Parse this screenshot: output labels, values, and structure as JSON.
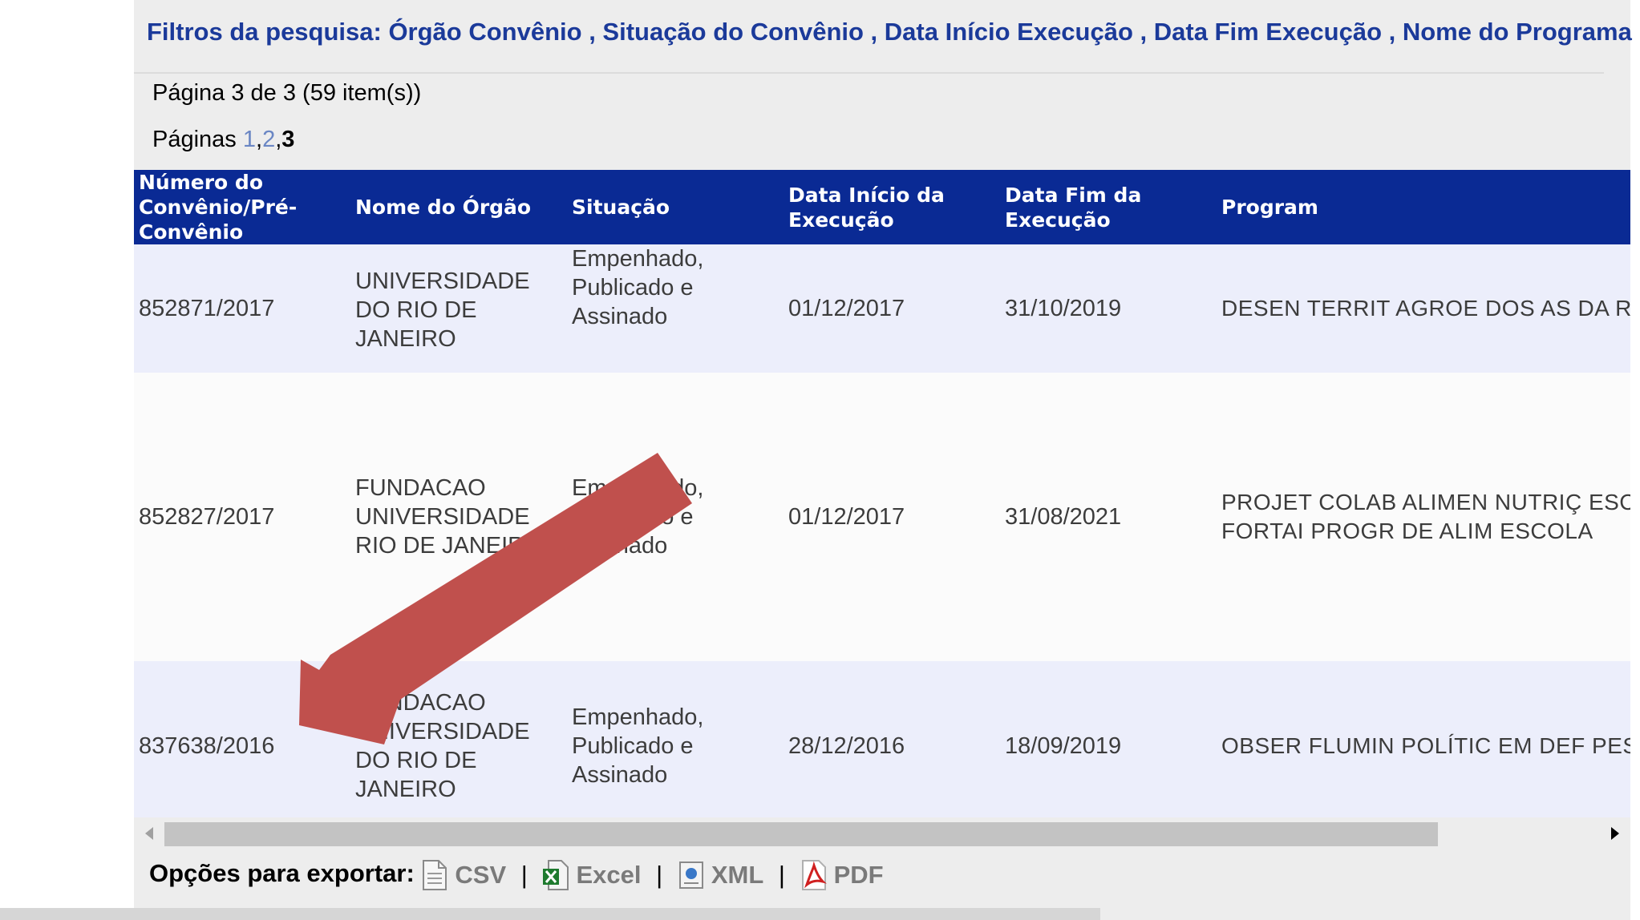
{
  "filters_text": "Filtros da pesquisa: Órgão Convênio , Situação do Convênio , Data Início Execução , Data Fim Execução , Nome do Programa",
  "page_info": "Página 3 de 3 (59 item(s))",
  "pagination": {
    "label": "Páginas",
    "p1": "1",
    "p2": "2",
    "p3": "3",
    "comma": ","
  },
  "table": {
    "headers": [
      "Número do Convênio/Pré-Convênio",
      "Nome do Órgão",
      "Situação",
      "Data Início da Execução",
      "Data Fim da Execução",
      "Program"
    ],
    "rows": [
      {
        "numero": "852871/2017",
        "orgao": "UNIVERSIDADE DO RIO DE JANEIRO",
        "situacao": "Empenhado, Publicado e Assinado",
        "inicio": "01/12/2017",
        "fim": "31/10/2019",
        "programa": "DESEN TERRIT AGROE DOS AS DA REF"
      },
      {
        "numero": "852827/2017",
        "orgao": "FUNDACAO UNIVERSIDADE RIO DE JANEIRO",
        "situacao": "Empenhado, Publicado e Assinado",
        "inicio": "01/12/2017",
        "fim": "31/08/2021",
        "programa": "PROJET COLAB ALIMEN NUTRIÇ ESCOLA UNIRIO FORTAI PROGR DE ALIM ESCOLA"
      },
      {
        "numero": "837638/2016",
        "orgao": "FUNDACAO UNIVERSIDADE DO RIO DE JANEIRO",
        "situacao": "Empenhado, Publicado e Assinado",
        "inicio": "28/12/2016",
        "fim": "18/09/2019",
        "programa": "OBSER FLUMIN POLÍTIC EM DEF PESSO DEFICII"
      }
    ]
  },
  "export": {
    "label": "Opções para exportar:",
    "csv": "CSV",
    "excel": "Excel",
    "xml": "XML",
    "pdf": "PDF",
    "sep": "|"
  },
  "colors": {
    "header_bg": "#0a2a94",
    "filter_text": "#1b3a9a",
    "arrow": "#c0504d"
  },
  "icons": [
    "csv-file-icon",
    "excel-file-icon",
    "xml-file-icon",
    "pdf-file-icon"
  ]
}
